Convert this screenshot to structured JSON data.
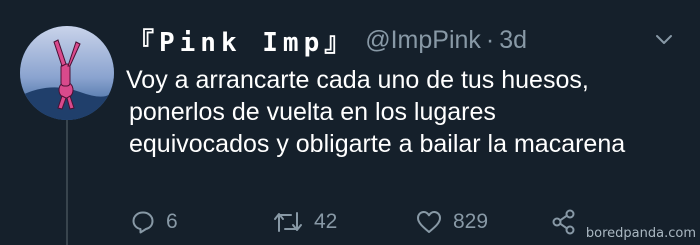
{
  "tweet": {
    "display_name": "『Pink Imp』",
    "handle": "@ImpPink",
    "separator": "·",
    "timestamp": "3d",
    "text_lines": [
      "Voy a arrancarte cada uno de tus huesos,",
      "ponerlos de vuelta en los lugares",
      "equivocados y obligarte a bailar la macarena"
    ]
  },
  "actions": {
    "reply_count": "6",
    "retweet_count": "42",
    "like_count": "829"
  },
  "icons": {
    "reply": "reply-icon",
    "retweet": "retweet-icon",
    "like": "heart-icon",
    "share": "share-icon",
    "menu": "chevron-down-icon"
  },
  "watermark": "boredpanda.com",
  "colors": {
    "background": "#15202b",
    "text": "#ffffff",
    "muted": "#8899a6",
    "thread_line": "#38444d"
  }
}
